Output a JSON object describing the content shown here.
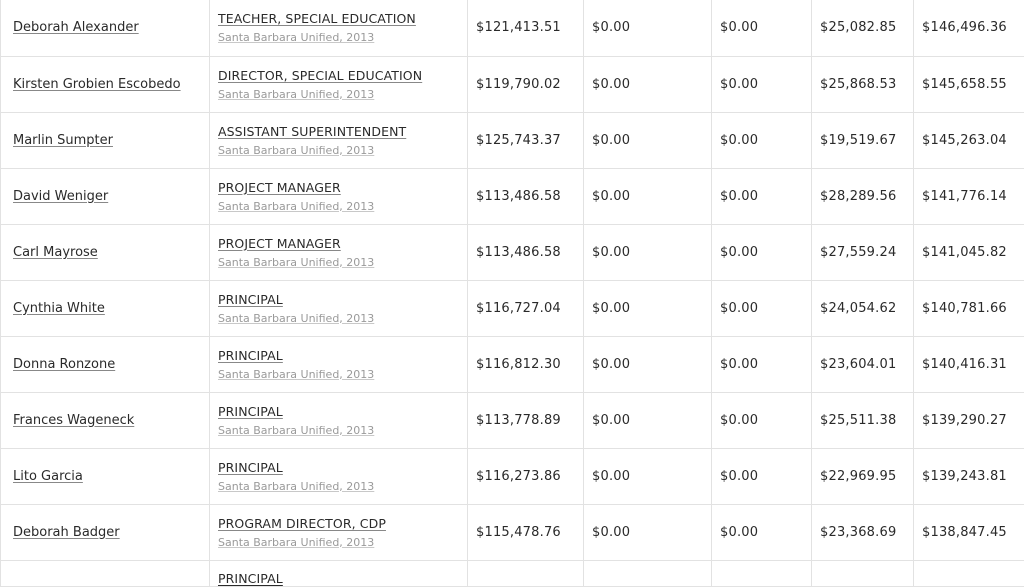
{
  "rows": [
    {
      "name": "Deborah Alexander",
      "title": "TEACHER, SPECIAL EDUCATION",
      "agency": "Santa Barbara Unified, 2013",
      "regular": "$121,413.51",
      "overtime": "$0.00",
      "other": "$0.00",
      "benefits": "$25,082.85",
      "total": "$146,496.36"
    },
    {
      "name": "Kirsten Grobien Escobedo",
      "title": "DIRECTOR, SPECIAL EDUCATION",
      "agency": "Santa Barbara Unified, 2013",
      "regular": "$119,790.02",
      "overtime": "$0.00",
      "other": "$0.00",
      "benefits": "$25,868.53",
      "total": "$145,658.55"
    },
    {
      "name": "Marlin Sumpter",
      "title": "ASSISTANT SUPERINTENDENT",
      "agency": "Santa Barbara Unified, 2013",
      "regular": "$125,743.37",
      "overtime": "$0.00",
      "other": "$0.00",
      "benefits": "$19,519.67",
      "total": "$145,263.04"
    },
    {
      "name": "David Weniger",
      "title": "PROJECT MANAGER",
      "agency": "Santa Barbara Unified, 2013",
      "regular": "$113,486.58",
      "overtime": "$0.00",
      "other": "$0.00",
      "benefits": "$28,289.56",
      "total": "$141,776.14"
    },
    {
      "name": "Carl Mayrose",
      "title": "PROJECT MANAGER",
      "agency": "Santa Barbara Unified, 2013",
      "regular": "$113,486.58",
      "overtime": "$0.00",
      "other": "$0.00",
      "benefits": "$27,559.24",
      "total": "$141,045.82"
    },
    {
      "name": "Cynthia White",
      "title": "PRINCIPAL",
      "agency": "Santa Barbara Unified, 2013",
      "regular": "$116,727.04",
      "overtime": "$0.00",
      "other": "$0.00",
      "benefits": "$24,054.62",
      "total": "$140,781.66"
    },
    {
      "name": "Donna Ronzone",
      "title": "PRINCIPAL",
      "agency": "Santa Barbara Unified, 2013",
      "regular": "$116,812.30",
      "overtime": "$0.00",
      "other": "$0.00",
      "benefits": "$23,604.01",
      "total": "$140,416.31"
    },
    {
      "name": "Frances Wageneck",
      "title": "PRINCIPAL",
      "agency": "Santa Barbara Unified, 2013",
      "regular": "$113,778.89",
      "overtime": "$0.00",
      "other": "$0.00",
      "benefits": "$25,511.38",
      "total": "$139,290.27"
    },
    {
      "name": "Lito Garcia",
      "title": "PRINCIPAL",
      "agency": "Santa Barbara Unified, 2013",
      "regular": "$116,273.86",
      "overtime": "$0.00",
      "other": "$0.00",
      "benefits": "$22,969.95",
      "total": "$139,243.81"
    },
    {
      "name": "Deborah Badger",
      "title": "PROGRAM DIRECTOR, CDP",
      "agency": "Santa Barbara Unified, 2013",
      "regular": "$115,478.76",
      "overtime": "$0.00",
      "other": "$0.00",
      "benefits": "$23,368.69",
      "total": "$138,847.45"
    }
  ],
  "partial_row": {
    "title": "PRINCIPAL"
  }
}
